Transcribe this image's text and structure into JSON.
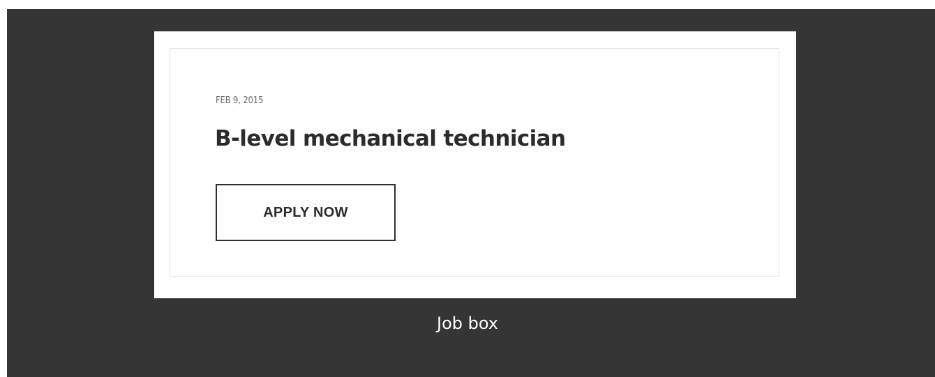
{
  "job_box": {
    "date": "FEB 9, 2015",
    "title": "B-level mechanical technician",
    "apply_button_label": "APPLY NOW"
  },
  "caption": "Job box",
  "colors": {
    "background_dark": "#353535",
    "card_background": "#ffffff",
    "card_border": "#e4e4e4",
    "title_text": "#2b2b2b",
    "date_text": "#6e6e6e",
    "button_border": "#2f2f2f",
    "caption_text": "#ffffff"
  }
}
